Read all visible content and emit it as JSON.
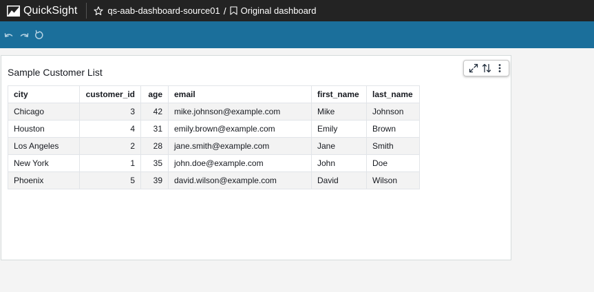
{
  "topbar": {
    "app_name": "QuickSight",
    "analysis_name": "qs-aab-dashboard-source01",
    "separator": "/",
    "dashboard_name": "Original dashboard"
  },
  "toolbar": {
    "icons": [
      "undo-icon",
      "redo-icon",
      "reset-icon"
    ]
  },
  "visual": {
    "title": "Sample Customer List",
    "menu_icons": [
      "expand-icon",
      "sort-icon",
      "more-options-icon"
    ],
    "columns": [
      "city",
      "customer_id",
      "age",
      "email",
      "first_name",
      "last_name"
    ],
    "rows": [
      {
        "city": "Chicago",
        "customer_id": "3",
        "age": "42",
        "email": "mike.johnson@example.com",
        "first_name": "Mike",
        "last_name": "Johnson"
      },
      {
        "city": "Houston",
        "customer_id": "4",
        "age": "31",
        "email": "emily.brown@example.com",
        "first_name": "Emily",
        "last_name": "Brown"
      },
      {
        "city": "Los Angeles",
        "customer_id": "2",
        "age": "28",
        "email": "jane.smith@example.com",
        "first_name": "Jane",
        "last_name": "Smith"
      },
      {
        "city": "New York",
        "customer_id": "1",
        "age": "35",
        "email": "john.doe@example.com",
        "first_name": "John",
        "last_name": "Doe"
      },
      {
        "city": "Phoenix",
        "customer_id": "5",
        "age": "39",
        "email": "david.wilson@example.com",
        "first_name": "David",
        "last_name": "Wilson"
      }
    ]
  },
  "colors": {
    "topbar_bg": "#232323",
    "toolbar_bg": "#1b6f9b",
    "page_bg": "#f4f4f4"
  }
}
